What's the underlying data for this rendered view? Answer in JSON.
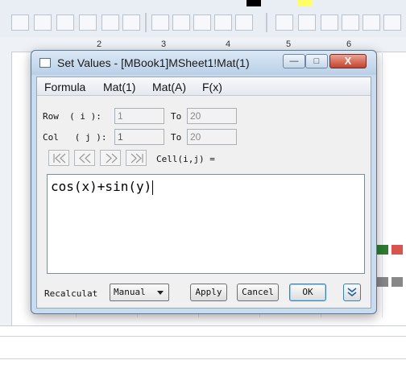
{
  "background": {
    "column_headers": [
      "2",
      "3",
      "4",
      "5",
      "6"
    ]
  },
  "dialog": {
    "title": "Set Values - [MBook1]MSheet1!Mat(1)",
    "minimize_label": "—",
    "maximize_label": "□",
    "close_label": "X",
    "menu": [
      "Formula",
      "Mat(1)",
      "Mat(A)",
      "F(x)"
    ],
    "row_label": "Row  ( i ):",
    "col_label": "Col   ( j ):",
    "row_from": "1",
    "row_to_label": "To",
    "row_to": "20",
    "col_from": "1",
    "col_to_label": "To",
    "col_to": "20",
    "cell_label": "Cell(i,j) =",
    "formula": "cos(x)+sin(y)",
    "recalculate_label": "Recalculat",
    "recalculate_value": "Manual",
    "apply_label": "Apply",
    "cancel_label": "Cancel",
    "ok_label": "OK"
  },
  "icons": {
    "first": "first-icon",
    "prev": "previous-icon",
    "next": "next-icon",
    "last": "last-icon",
    "expand": "chevron-down-icon"
  },
  "colors": {
    "titlebar": "#c9dcef",
    "close": "#c4422b",
    "ok_border": "#3c7fb1"
  }
}
